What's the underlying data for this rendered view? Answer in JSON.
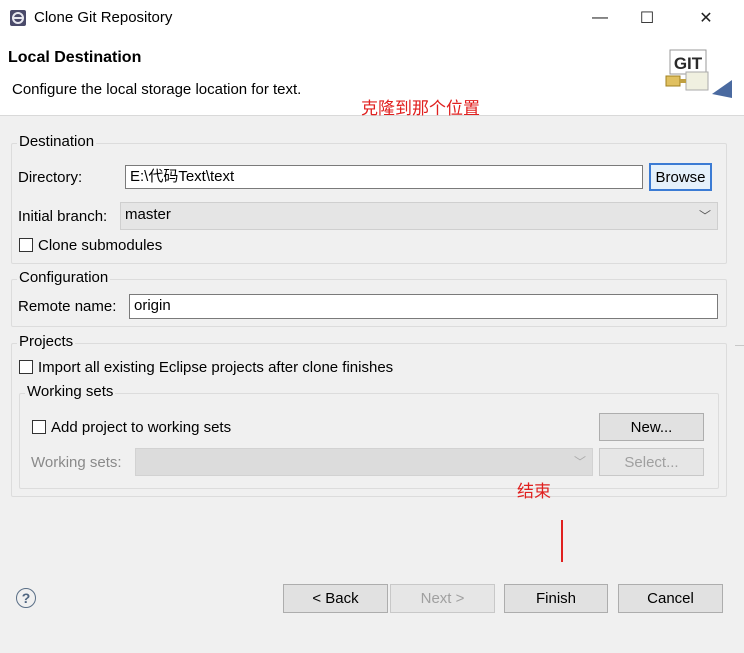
{
  "window": {
    "title": "Clone Git Repository",
    "minimize": "—",
    "maximize": "☐",
    "close": "✕"
  },
  "header": {
    "title": "Local Destination",
    "description": "Configure the local storage location for text.",
    "logo_text": "GIT"
  },
  "annotations": {
    "clone_location": "克隆到那个位置",
    "finish": "结束",
    "color": "#e0201f"
  },
  "destination": {
    "legend": "Destination",
    "directory_label": "Directory:",
    "directory_value": "E:\\代码Text\\text",
    "browse_label": "Browse",
    "branch_label": "Initial branch:",
    "branch_value": "master",
    "clone_submodules_label": "Clone submodules"
  },
  "configuration": {
    "legend": "Configuration",
    "remote_label": "Remote name:",
    "remote_value": "origin"
  },
  "projects": {
    "legend": "Projects",
    "import_label": "Import all existing Eclipse projects after clone finishes",
    "working_sets": {
      "legend": "Working sets",
      "add_label": "Add project to working sets",
      "new_label": "New...",
      "sets_label": "Working sets:",
      "select_label": "Select..."
    }
  },
  "footer": {
    "help_icon": "?",
    "back_label": "< Back",
    "next_label": "Next >",
    "finish_label": "Finish",
    "cancel_label": "Cancel"
  }
}
